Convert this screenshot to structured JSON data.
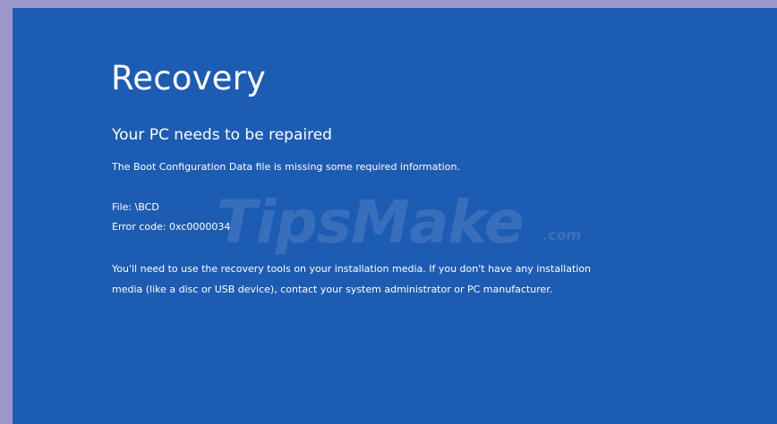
{
  "screen": {
    "title": "Recovery",
    "subtitle": "Your PC needs to be repaired",
    "description": "The Boot Configuration Data file is missing some required information.",
    "file_line": "File: \\BCD",
    "error_line": "Error code: 0xc0000034",
    "instruction_line1": "You'll need to use the recovery tools on your installation media. If you don't have any installation",
    "instruction_line2": "media (like a disc or USB device), contact your system administrator or PC manufacturer."
  },
  "watermark": {
    "brand": "TipsMake",
    "suffix": ".com"
  },
  "colors": {
    "background": "#1d5cb3",
    "frame": "#9b97c9",
    "text": "#ffffff"
  }
}
